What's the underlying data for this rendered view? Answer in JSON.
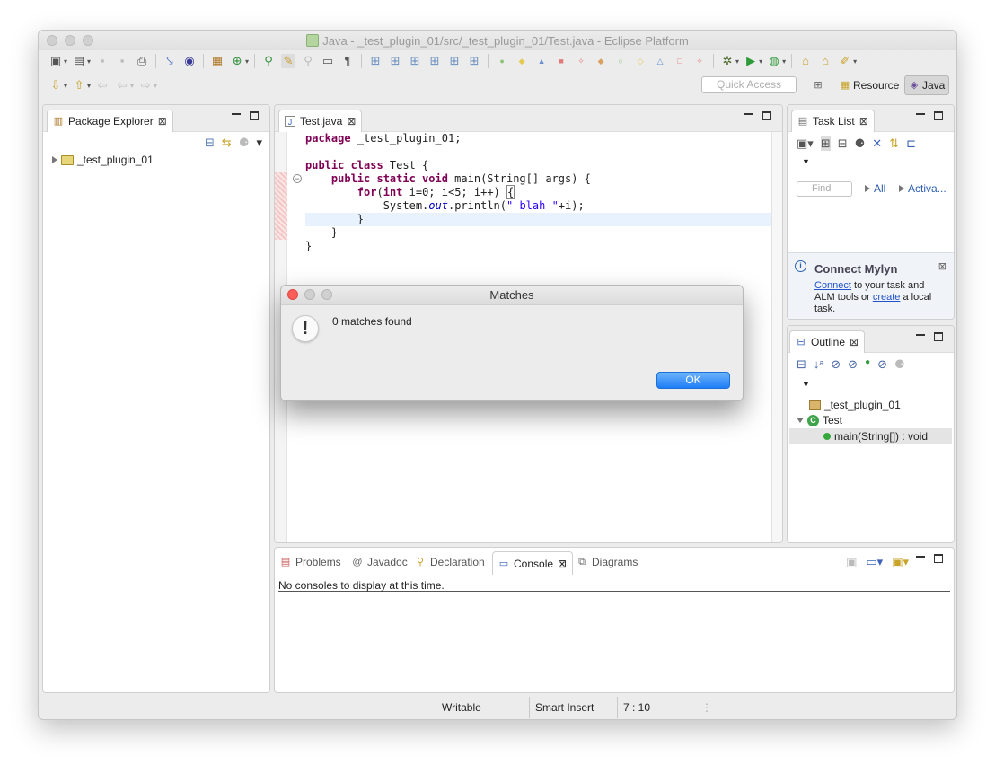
{
  "window": {
    "title": "Java - _test_plugin_01/src/_test_plugin_01/Test.java - Eclipse Platform"
  },
  "quick_access": {
    "placeholder": "Quick Access"
  },
  "perspectives": {
    "resource": "Resource",
    "java": "Java"
  },
  "package_explorer": {
    "tab_label": "Package Explorer",
    "tree": [
      {
        "label": "_test_plugin_01",
        "expanded": false
      }
    ]
  },
  "editor": {
    "tab_label": "Test.java",
    "lines": [
      "package _test_plugin_01;",
      "",
      "public class Test {",
      "    public static void main(String[] args) {",
      "        for(int i=0; i<5; i++) {",
      "            System.out.println(\" blah \"+i);",
      "        }",
      "    }",
      "}"
    ]
  },
  "task_list": {
    "tab_label": "Task List",
    "find_placeholder": "Find",
    "filter_all": "All",
    "filter_activate": "Activa...",
    "mylyn": {
      "title": "Connect Mylyn",
      "link_connect": "Connect",
      "text_1": " to your task and ALM tools or ",
      "link_create": "create",
      "text_2": " a local task."
    }
  },
  "outline": {
    "tab_label": "Outline",
    "items": {
      "package": "_test_plugin_01",
      "class": "Test",
      "method": "main(String[]) : void"
    }
  },
  "bottom_panel": {
    "tabs": {
      "problems": "Problems",
      "javadoc": "Javadoc",
      "declaration": "Declaration",
      "console": "Console",
      "diagrams": "Diagrams"
    },
    "console_message": "No consoles to display at this time."
  },
  "status_bar": {
    "writable": "Writable",
    "insert_mode": "Smart Insert",
    "position": "7 : 10"
  },
  "dialog": {
    "title": "Matches",
    "message": "0 matches found",
    "ok_label": "OK"
  },
  "colors": {
    "keyword": "#7f0055",
    "string": "#2a00ff",
    "ok_button": "#1f7ef6",
    "close_red": "#fc5f57"
  }
}
